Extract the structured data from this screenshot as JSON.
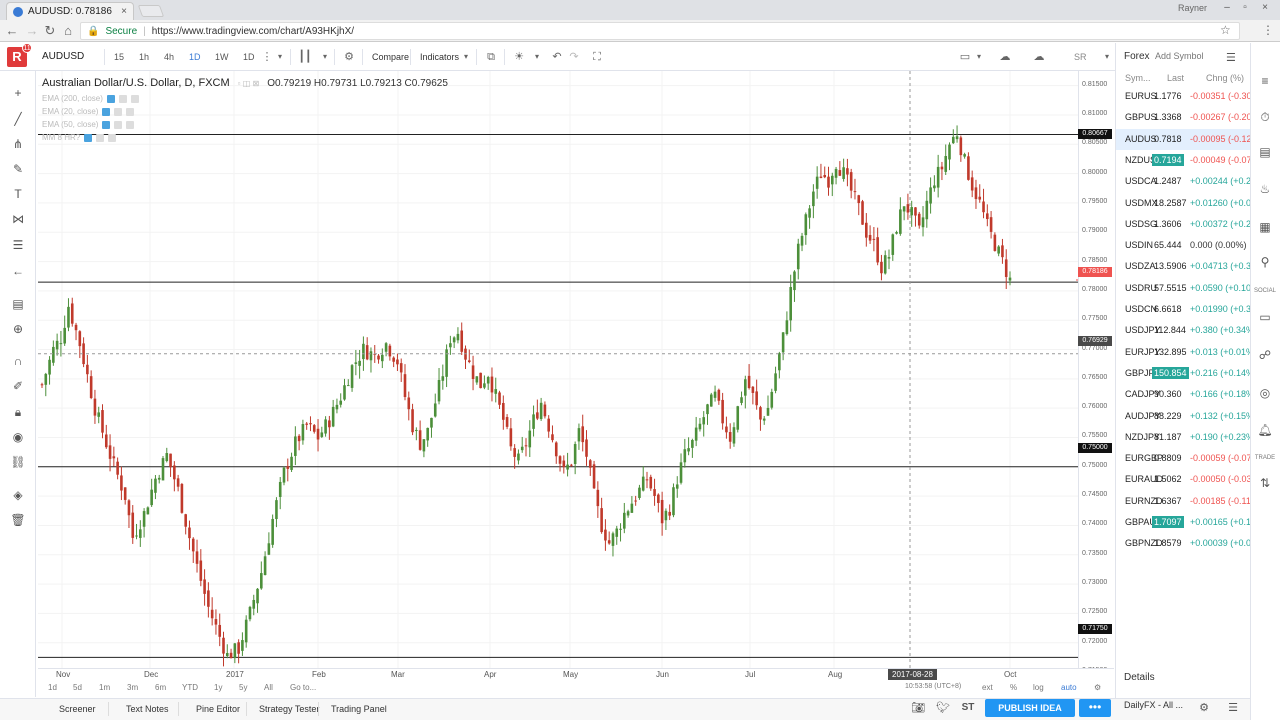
{
  "browser": {
    "tab_title": "AUDUSD: 0.78186 ▼ -0.1",
    "tab_close": "×",
    "profile": "Rayner",
    "secure_label": "Secure",
    "url": "https://www.tradingview.com/chart/A93HKjhX/"
  },
  "header": {
    "logo": "R",
    "notif_count": "11",
    "symbol": "AUDUSD",
    "timeframes": [
      "15",
      "1h",
      "4h",
      "1D",
      "1W",
      "1D"
    ],
    "active_timeframe": "1D",
    "compare_label": "Compare",
    "indicators_label": "Indicators",
    "user_initials": "SR"
  },
  "chart_legend": {
    "title": "Australian Dollar/U.S. Dollar, D, FXCM",
    "ohlc": "O0.79219  H0.79731  L0.79213  C0.79625",
    "indicators": [
      "EMA (200, close)",
      "EMA (20, close)",
      "EMA (50, close)",
      "MM 8 HR?"
    ]
  },
  "chart_data": {
    "type": "candlestick",
    "title": "Australian Dollar/U.S. Dollar, D, FXCM",
    "symbol": "AUDUSD",
    "ylim": [
      0.7133,
      0.8175
    ],
    "y_ticks": [
      0.815,
      0.81,
      0.805,
      0.8,
      0.795,
      0.79,
      0.785,
      0.78,
      0.775,
      0.77,
      0.765,
      0.76,
      0.755,
      0.75,
      0.745,
      0.74,
      0.735,
      0.73,
      0.725,
      0.72,
      0.715
    ],
    "x_ticks": [
      "Nov",
      "Dec",
      "2017",
      "Feb",
      "Mar",
      "Apr",
      "May",
      "Jun",
      "Jul",
      "Aug",
      "2017-08-28",
      "Oct"
    ],
    "horizontal_lines": [
      0.80667,
      0.7815,
      0.75,
      0.7175
    ],
    "last_price": 0.78186,
    "crosshair_price": 0.76929,
    "crosshair_date": "2017-08-28",
    "major_levels_labels": [
      "0.80667",
      "0.78186",
      "0.76929",
      "0.75000",
      "0.71750"
    ],
    "swing_path": [
      [
        0,
        0.764
      ],
      [
        3,
        0.77
      ],
      [
        5,
        0.772
      ],
      [
        7,
        0.7775
      ],
      [
        10,
        0.771
      ],
      [
        14,
        0.76
      ],
      [
        18,
        0.752
      ],
      [
        22,
        0.745
      ],
      [
        24,
        0.738
      ],
      [
        27,
        0.742
      ],
      [
        30,
        0.748
      ],
      [
        33,
        0.752
      ],
      [
        36,
        0.746
      ],
      [
        39,
        0.738
      ],
      [
        41,
        0.733
      ],
      [
        44,
        0.726
      ],
      [
        47,
        0.721
      ],
      [
        49,
        0.7178
      ],
      [
        52,
        0.719
      ],
      [
        55,
        0.725
      ],
      [
        58,
        0.732
      ],
      [
        61,
        0.741
      ],
      [
        64,
        0.749
      ],
      [
        67,
        0.754
      ],
      [
        70,
        0.757
      ],
      [
        73,
        0.755
      ],
      [
        76,
        0.758
      ],
      [
        79,
        0.762
      ],
      [
        82,
        0.767
      ],
      [
        85,
        0.77
      ],
      [
        88,
        0.769
      ],
      [
        91,
        0.771
      ],
      [
        94,
        0.768
      ],
      [
        96,
        0.762
      ],
      [
        98,
        0.757
      ],
      [
        100,
        0.754
      ],
      [
        102,
        0.756
      ],
      [
        104,
        0.761
      ],
      [
        106,
        0.766
      ],
      [
        108,
        0.772
      ],
      [
        110,
        0.773
      ],
      [
        112,
        0.769
      ],
      [
        114,
        0.766
      ],
      [
        116,
        0.764
      ],
      [
        118,
        0.766
      ],
      [
        120,
        0.762
      ],
      [
        122,
        0.758
      ],
      [
        124,
        0.753
      ],
      [
        126,
        0.751
      ],
      [
        128,
        0.754
      ],
      [
        130,
        0.758
      ],
      [
        132,
        0.761
      ],
      [
        134,
        0.757
      ],
      [
        136,
        0.753
      ],
      [
        138,
        0.749
      ],
      [
        140,
        0.751
      ],
      [
        142,
        0.756
      ],
      [
        144,
        0.752
      ],
      [
        146,
        0.745
      ],
      [
        148,
        0.74
      ],
      [
        150,
        0.737
      ],
      [
        152,
        0.739
      ],
      [
        154,
        0.742
      ],
      [
        156,
        0.744
      ],
      [
        158,
        0.746
      ],
      [
        160,
        0.748
      ],
      [
        162,
        0.745
      ],
      [
        164,
        0.741
      ],
      [
        166,
        0.743
      ],
      [
        168,
        0.748
      ],
      [
        170,
        0.752
      ],
      [
        172,
        0.754
      ],
      [
        174,
        0.757
      ],
      [
        176,
        0.76
      ],
      [
        178,
        0.762
      ],
      [
        180,
        0.758
      ],
      [
        182,
        0.755
      ],
      [
        184,
        0.76
      ],
      [
        186,
        0.765
      ],
      [
        188,
        0.762
      ],
      [
        190,
        0.758
      ],
      [
        192,
        0.76
      ],
      [
        194,
        0.766
      ],
      [
        196,
        0.772
      ],
      [
        198,
        0.78
      ],
      [
        200,
        0.787
      ],
      [
        202,
        0.792
      ],
      [
        204,
        0.797
      ],
      [
        206,
        0.8
      ],
      [
        208,
        0.799
      ],
      [
        210,
        0.802
      ],
      [
        212,
        0.8
      ],
      [
        214,
        0.797
      ],
      [
        216,
        0.794
      ],
      [
        218,
        0.79
      ],
      [
        220,
        0.788
      ],
      [
        222,
        0.784
      ],
      [
        224,
        0.786
      ],
      [
        226,
        0.791
      ],
      [
        228,
        0.795
      ],
      [
        230,
        0.793
      ],
      [
        232,
        0.79
      ],
      [
        234,
        0.795
      ],
      [
        236,
        0.799
      ],
      [
        238,
        0.801
      ],
      [
        240,
        0.805
      ],
      [
        242,
        0.807
      ],
      [
        244,
        0.802
      ],
      [
        246,
        0.798
      ],
      [
        248,
        0.795
      ],
      [
        250,
        0.791
      ],
      [
        252,
        0.788
      ],
      [
        254,
        0.785
      ],
      [
        256,
        0.7818
      ]
    ]
  },
  "price_axis": {
    "ticks": [
      "0.81500",
      "0.81000",
      "0.80500",
      "0.80000",
      "0.79500",
      "0.79000",
      "0.78500",
      "0.78000",
      "0.77500",
      "0.77000",
      "0.76500",
      "0.76000",
      "0.75500",
      "0.75000",
      "0.74500",
      "0.74000",
      "0.73500",
      "0.73000",
      "0.72500",
      "0.72000",
      "0.71500"
    ],
    "badge_top": "0.80667",
    "badge_last": "0.78186",
    "badge_cross": "0.76929",
    "badge_750": "0.75000",
    "badge_bottom": "0.71750"
  },
  "time_axis": {
    "labels": [
      "Nov",
      "Dec",
      "2017",
      "Feb",
      "Mar",
      "Apr",
      "May",
      "Jun",
      "Jul",
      "Aug",
      "Oct"
    ],
    "crosshair_date": "2017-08-28"
  },
  "range_bar": {
    "ranges": [
      "1d",
      "5d",
      "1m",
      "3m",
      "6m",
      "YTD",
      "1y",
      "5y",
      "All"
    ],
    "goto": "Go to...",
    "clock": "10:53:58 (UTC+8)",
    "options": [
      "ext",
      "%",
      "log",
      "auto"
    ]
  },
  "bottom_tabs": [
    "Screener",
    "Text Notes",
    "Pine Editor",
    "Strategy Tester",
    "Trading Panel"
  ],
  "publish_label": "PUBLISH IDEA",
  "watchlist": {
    "title": "Forex",
    "add_symbol": "Add Symbol",
    "columns": [
      "Sym...",
      "Last",
      "Chng (%)"
    ],
    "rows": [
      {
        "sym": "EURUS",
        "last": "1.1776",
        "chg": "-0.00351 (-0.30",
        "dir": "down"
      },
      {
        "sym": "GBPUS",
        "last": "1.3368",
        "chg": "-0.00267 (-0.20",
        "dir": "down"
      },
      {
        "sym": "AUDUS",
        "last": "0.7818",
        "chg": "-0.00095 (-0.12",
        "dir": "down",
        "selected": true
      },
      {
        "sym": "NZDUS",
        "last": "0.7194",
        "chg": "-0.00049 (-0.07",
        "dir": "down",
        "highlight": true
      },
      {
        "sym": "USDCA",
        "last": "1.2487",
        "chg": "+0.00244 (+0.2",
        "dir": "up"
      },
      {
        "sym": "USDMX",
        "last": "18.2587",
        "chg": "+0.01260 (+0.0",
        "dir": "up"
      },
      {
        "sym": "USDSG",
        "last": "1.3606",
        "chg": "+0.00372 (+0.2",
        "dir": "up"
      },
      {
        "sym": "USDIN",
        "last": "65.444",
        "chg": "0.000 (0.00%)",
        "dir": "flat"
      },
      {
        "sym": "USDZA",
        "last": "13.5906",
        "chg": "+0.04713 (+0.3",
        "dir": "up"
      },
      {
        "sym": "USDRU",
        "last": "57.5515",
        "chg": "+0.0590 (+0.10",
        "dir": "up"
      },
      {
        "sym": "USDCN",
        "last": "6.6618",
        "chg": "+0.01990 (+0.3",
        "dir": "up"
      },
      {
        "sym": "USDJPY",
        "last": "112.844",
        "chg": "+0.380 (+0.34%",
        "dir": "up"
      },
      {
        "sym": "EURJPY",
        "last": "132.895",
        "chg": "+0.013 (+0.01%",
        "dir": "up"
      },
      {
        "sym": "GBPJPY",
        "last": "150.854",
        "chg": "+0.216 (+0.14%",
        "dir": "up",
        "highlight": true
      },
      {
        "sym": "CADJPY",
        "last": "90.360",
        "chg": "+0.166 (+0.18%",
        "dir": "up"
      },
      {
        "sym": "AUDJPY",
        "last": "88.229",
        "chg": "+0.132 (+0.15%",
        "dir": "up"
      },
      {
        "sym": "NZDJPY",
        "last": "81.187",
        "chg": "+0.190 (+0.23%",
        "dir": "up"
      },
      {
        "sym": "EURGBP",
        "last": "0.8809",
        "chg": "-0.00059 (-0.07",
        "dir": "down"
      },
      {
        "sym": "EURAUD",
        "last": "1.5062",
        "chg": "-0.00050 (-0.03",
        "dir": "down"
      },
      {
        "sym": "EURNZD",
        "last": "1.6367",
        "chg": "-0.00185 (-0.11",
        "dir": "down"
      },
      {
        "sym": "GBPAUD",
        "last": "1.7097",
        "chg": "+0.00165 (+0.1",
        "dir": "up",
        "highlight": true
      },
      {
        "sym": "GBPNZD",
        "last": "1.8579",
        "chg": "+0.00039 (+0.0",
        "dir": "up"
      }
    ],
    "details_label": "Details",
    "footer": "DailyFX - All ..."
  },
  "rail_labels": {
    "social": "SOCIAL",
    "trade": "TRADE"
  },
  "colors": {
    "up": "#26a69a",
    "down": "#ef5350",
    "accent": "#2196f3",
    "candle_up": "#4c8f3a",
    "candle_down": "#c0392b"
  }
}
